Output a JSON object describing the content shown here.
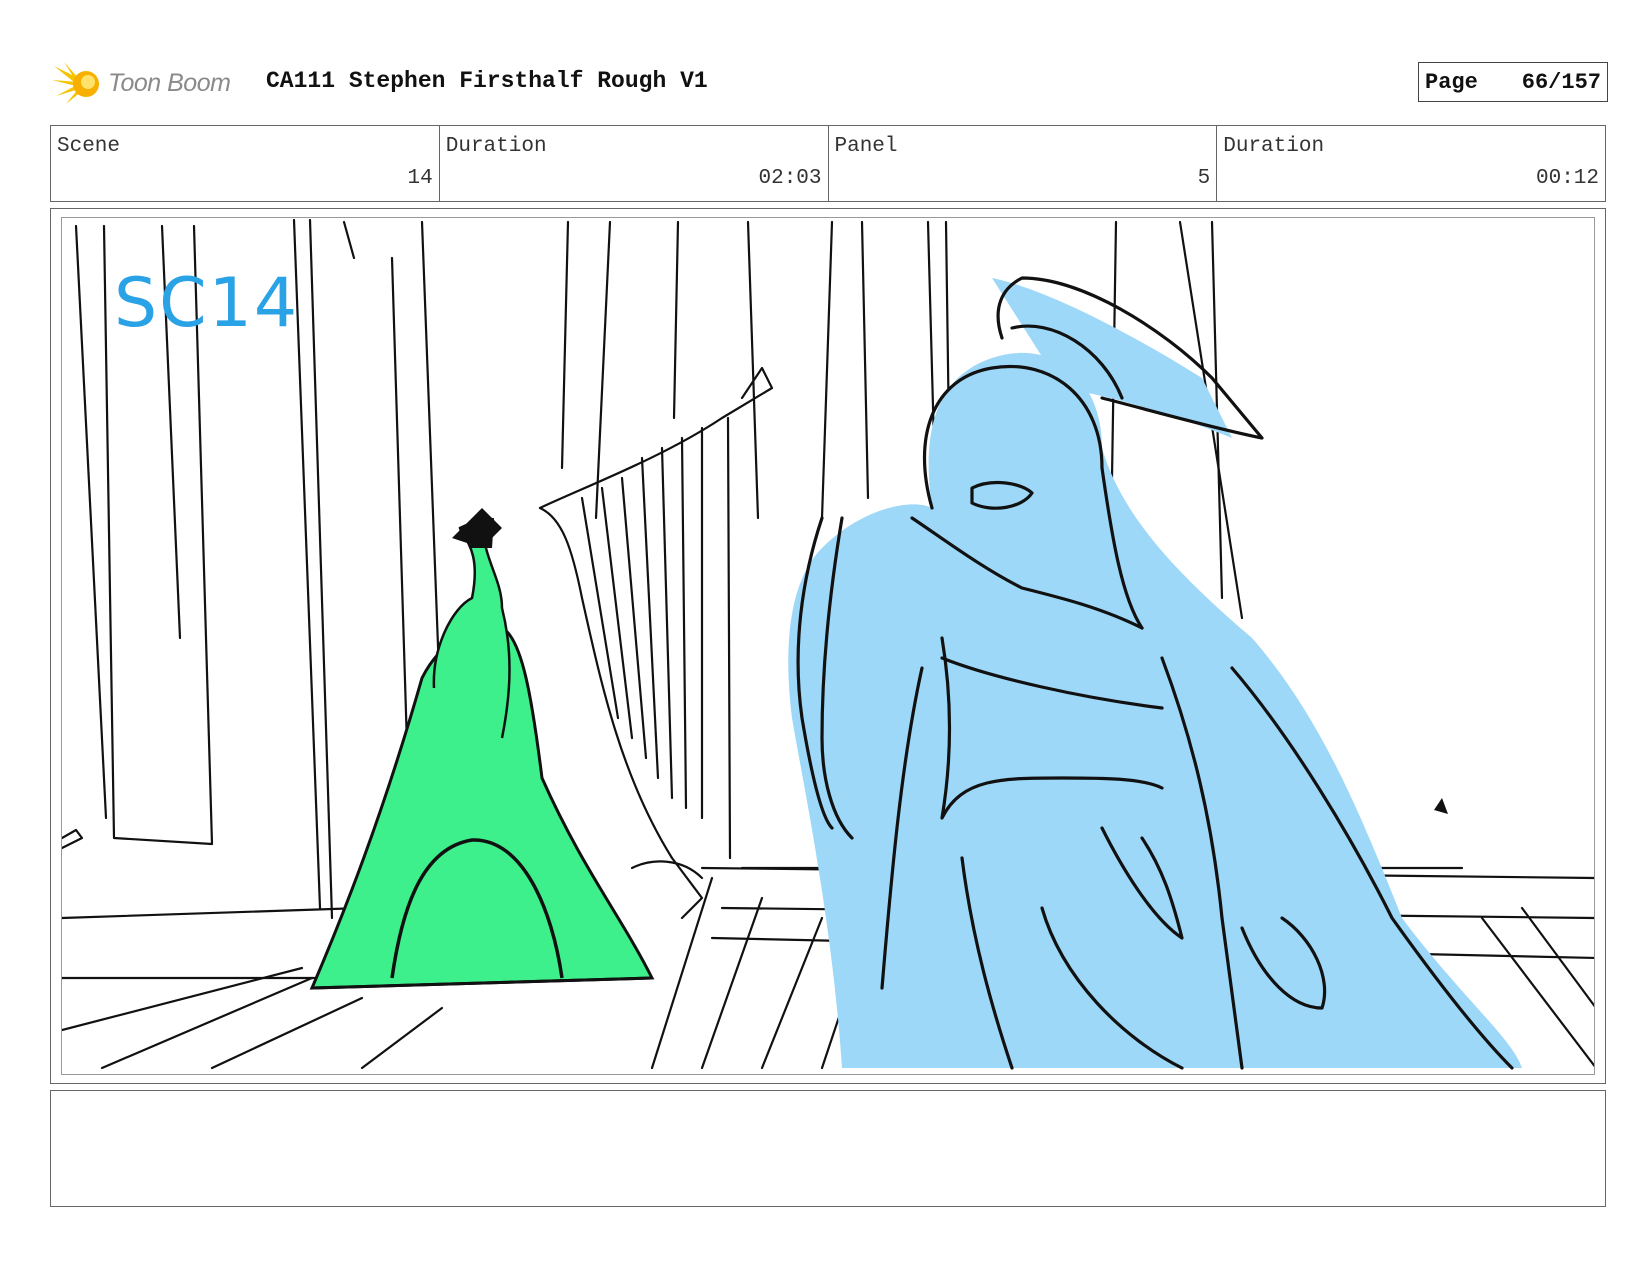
{
  "header": {
    "logo_text": "Toon Boom",
    "title": "CA111 Stephen Firsthalf Rough V1",
    "page_label": "Page",
    "page_value": "66/157"
  },
  "info": {
    "scene_label": "Scene",
    "scene_value": "14",
    "scene_duration_label": "Duration",
    "scene_duration_value": "02:03",
    "panel_label": "Panel",
    "panel_value": "5",
    "panel_duration_label": "Duration",
    "panel_duration_value": "00:12"
  },
  "sketch": {
    "annotation": "SC14",
    "colors": {
      "figure_left": "#3df08c",
      "figure_right": "#9dd8f8",
      "annotation": "#2aa2e6",
      "ink": "#111111"
    }
  },
  "notes": {
    "text": ""
  }
}
